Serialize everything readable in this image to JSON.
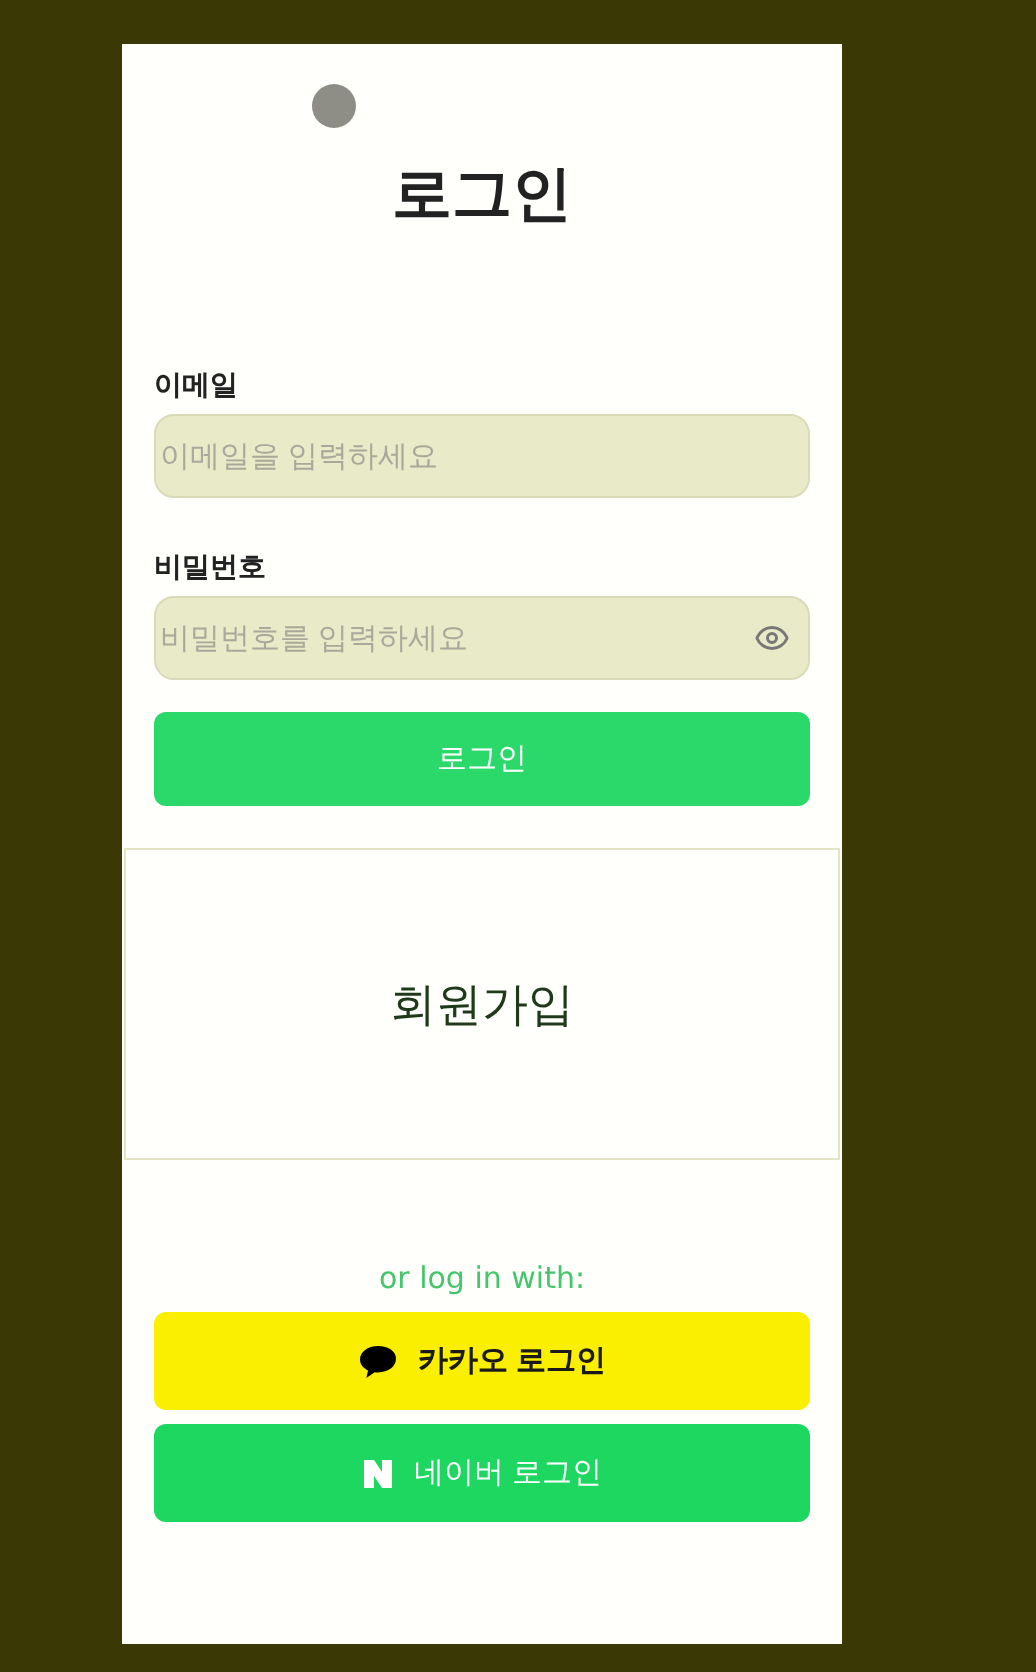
{
  "title": "로그인",
  "fields": [
    {
      "label": "이메일",
      "placeholder": "이메일을 입력하세요",
      "kind": "text"
    },
    {
      "label": "비밀번호",
      "placeholder": "비밀번호를 입력하세요",
      "kind": "password"
    }
  ],
  "login_button": "로그인",
  "signup": "회원가입",
  "social_caption": "or log in with:",
  "social_buttons": [
    {
      "label": "카카오 로그인",
      "kind": "kakao"
    },
    {
      "label": "네이버 로그인",
      "kind": "naver"
    }
  ]
}
